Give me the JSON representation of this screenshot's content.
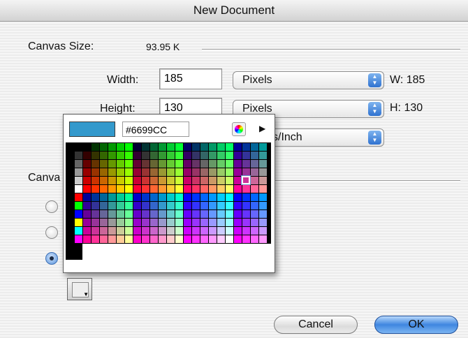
{
  "window": {
    "title": "New Document"
  },
  "canvas_size": {
    "label": "Canvas Size:",
    "value": "93.95 K"
  },
  "width": {
    "label": "Width:",
    "value": "185",
    "unit": "Pixels",
    "readout": "W: 185"
  },
  "height": {
    "label": "Height:",
    "value": "130",
    "unit": "Pixels",
    "readout": "H: 130"
  },
  "resolution": {
    "unit_partial": "s/Inch"
  },
  "canvas_section": {
    "label_partial": "Canva"
  },
  "color_picker": {
    "current_hex": "#6699CC",
    "current_color": "#3399CC",
    "flyout_icon": "triangle-right-icon",
    "wheel_icon": "color-wheel-icon"
  },
  "buttons": {
    "cancel": "Cancel",
    "ok": "OK"
  },
  "icons": {
    "arrows": "updown-arrows-icon",
    "doc": "canvas-color-icon"
  }
}
